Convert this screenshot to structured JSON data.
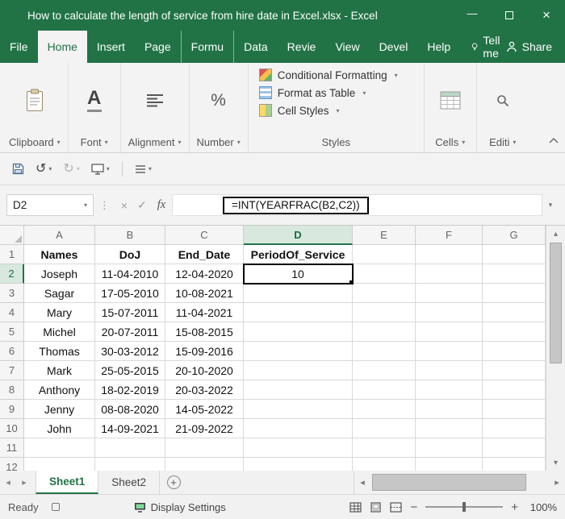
{
  "colors": {
    "accent": "#217346",
    "selection_border": "#000000"
  },
  "icons": {
    "dropdown": "▾",
    "up": "▴",
    "down": "▾",
    "prev": "◂",
    "next": "▸",
    "undo": "↺",
    "redo": "↻",
    "ellipsis": "⋮",
    "font_letter": "A",
    "percent": "%"
  },
  "window": {
    "title": "How to calculate the length of service from hire date in Excel.xlsx  -  Excel",
    "minimize_glyph": "—",
    "close_glyph": "×"
  },
  "menu": {
    "tabs": [
      {
        "label": "File"
      },
      {
        "label": "Home",
        "active": true
      },
      {
        "label": "Insert"
      },
      {
        "label": "Page",
        "sep": true
      },
      {
        "label": "Formu",
        "sep": true
      },
      {
        "label": "Data"
      },
      {
        "label": "Revie"
      },
      {
        "label": "View"
      },
      {
        "label": "Devel"
      },
      {
        "label": "Help"
      }
    ],
    "tell_me": "Tell me",
    "share": "Share"
  },
  "ribbon": {
    "groups": [
      {
        "label": "Clipboard"
      },
      {
        "label": "Font"
      },
      {
        "label": "Alignment"
      },
      {
        "label": "Number"
      },
      {
        "label": "Cells"
      },
      {
        "label": "Editi"
      }
    ],
    "styles": {
      "label": "Styles",
      "items": [
        "Conditional Formatting",
        "Format as Table",
        "Cell Styles"
      ]
    }
  },
  "formula_bar": {
    "name_box": "D2",
    "cancel_glyph": "×",
    "enter_glyph": "✓",
    "fx_label": "fx",
    "formula": "=INT(YEARFRAC(B2,C2))"
  },
  "grid": {
    "columns": [
      "A",
      "B",
      "C",
      "D",
      "E",
      "F",
      "G"
    ],
    "selected_column": "D",
    "selected_row": 2,
    "selected_cell": "D2",
    "rows": [
      {
        "n": 1,
        "bold": true,
        "cells": [
          "Names",
          "DoJ",
          "End_Date",
          "PeriodOf_Service",
          "",
          "",
          ""
        ]
      },
      {
        "n": 2,
        "cells": [
          "Joseph",
          "11-04-2010",
          "12-04-2020",
          "10",
          "",
          "",
          ""
        ]
      },
      {
        "n": 3,
        "cells": [
          "Sagar",
          "17-05-2010",
          "10-08-2021",
          "",
          "",
          "",
          ""
        ]
      },
      {
        "n": 4,
        "cells": [
          "Mary",
          "15-07-2011",
          "11-04-2021",
          "",
          "",
          "",
          ""
        ]
      },
      {
        "n": 5,
        "cells": [
          "Michel",
          "20-07-2011",
          "15-08-2015",
          "",
          "",
          "",
          ""
        ]
      },
      {
        "n": 6,
        "cells": [
          "Thomas",
          "30-03-2012",
          "15-09-2016",
          "",
          "",
          "",
          ""
        ]
      },
      {
        "n": 7,
        "cells": [
          "Mark",
          "25-05-2015",
          "20-10-2020",
          "",
          "",
          "",
          ""
        ]
      },
      {
        "n": 8,
        "cells": [
          "Anthony",
          "18-02-2019",
          "20-03-2022",
          "",
          "",
          "",
          ""
        ]
      },
      {
        "n": 9,
        "cells": [
          "Jenny",
          "08-08-2020",
          "14-05-2022",
          "",
          "",
          "",
          ""
        ]
      },
      {
        "n": 10,
        "cells": [
          "John",
          "14-09-2021",
          "21-09-2022",
          "",
          "",
          "",
          ""
        ]
      },
      {
        "n": 11,
        "cells": [
          "",
          "",
          "",
          "",
          "",
          "",
          ""
        ]
      },
      {
        "n": 12,
        "cells": [
          "",
          "",
          "",
          "",
          "",
          "",
          ""
        ]
      }
    ]
  },
  "sheet_tabs": {
    "tabs": [
      {
        "label": "Sheet1",
        "active": true
      },
      {
        "label": "Sheet2"
      }
    ],
    "add_glyph": "+"
  },
  "status_bar": {
    "ready": "Ready",
    "display_settings": "Display Settings",
    "zoom_out_glyph": "−",
    "zoom_in_glyph": "+",
    "zoom_level": "100%"
  }
}
